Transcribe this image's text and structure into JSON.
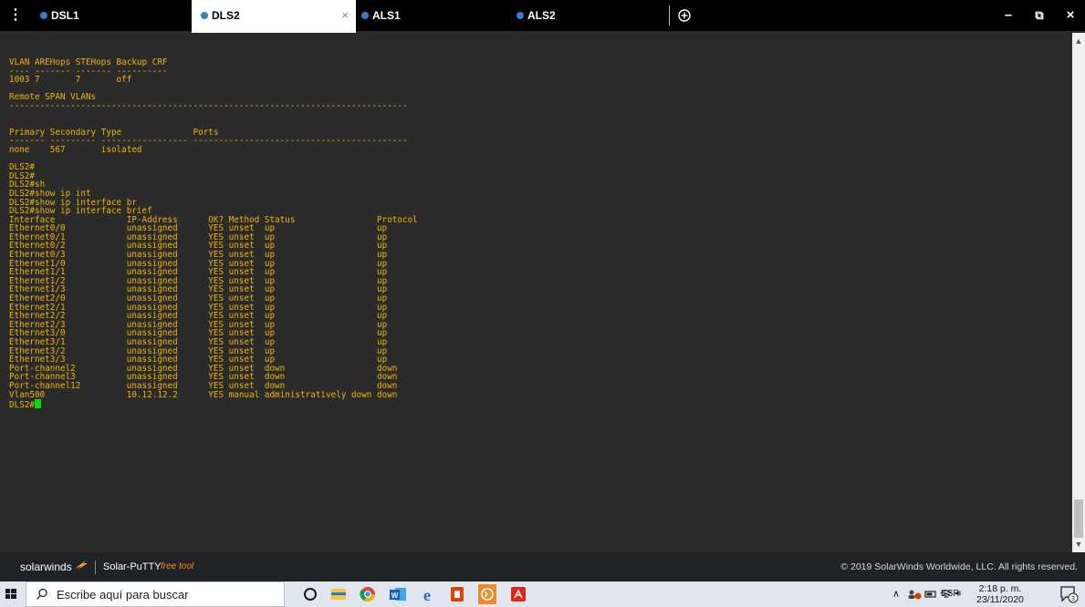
{
  "tabs": [
    {
      "label": "DSL1",
      "active": false,
      "dot_color": "#2f7fd6"
    },
    {
      "label": "DLS2",
      "active": true,
      "dot_color": "#2f7fd6"
    },
    {
      "label": "ALS1",
      "active": false,
      "dot_color": "#2f7fd6"
    },
    {
      "label": "ALS2",
      "active": false,
      "dot_color": "#2f7fd6"
    }
  ],
  "tab_close_symbol": "×",
  "menu_icon": "vertical-dots-icon",
  "add_tab_icon": "plus-circle-icon",
  "window_controls": {
    "minimize": "–",
    "restore": "⧉",
    "close": "×"
  },
  "terminal": {
    "text_color": "#f0b400",
    "lines": [
      "VLAN AREHops STEHops Backup CRF",
      "---- ------- ------- ----------",
      "1003 7       7       off",
      "",
      "Remote SPAN VLANs",
      "------------------------------------------------------------------------------",
      "",
      "",
      "Primary Secondary Type              Ports",
      "------- --------- ----------------- ------------------------------------------",
      "none    567       isolated",
      "",
      "DLS2#",
      "DLS2#",
      "DLS2#sh",
      "DLS2#show ip int",
      "DLS2#show ip interface br",
      "DLS2#show ip interface brief",
      "Interface              IP-Address      OK? Method Status                Protocol",
      "Ethernet0/0            unassigned      YES unset  up                    up",
      "Ethernet0/1            unassigned      YES unset  up                    up",
      "Ethernet0/2            unassigned      YES unset  up                    up",
      "Ethernet0/3            unassigned      YES unset  up                    up",
      "Ethernet1/0            unassigned      YES unset  up                    up",
      "Ethernet1/1            unassigned      YES unset  up                    up",
      "Ethernet1/2            unassigned      YES unset  up                    up",
      "Ethernet1/3            unassigned      YES unset  up                    up",
      "Ethernet2/0            unassigned      YES unset  up                    up",
      "Ethernet2/1            unassigned      YES unset  up                    up",
      "Ethernet2/2            unassigned      YES unset  up                    up",
      "Ethernet2/3            unassigned      YES unset  up                    up",
      "Ethernet3/0            unassigned      YES unset  up                    up",
      "Ethernet3/1            unassigned      YES unset  up                    up",
      "Ethernet3/2            unassigned      YES unset  up                    up",
      "Ethernet3/3            unassigned      YES unset  up                    up",
      "Port-channel2          unassigned      YES unset  down                  down",
      "Port-channel3          unassigned      YES unset  down                  down",
      "Port-channel12         unassigned      YES unset  down                  down",
      "Vlan500                10.12.12.2      YES manual administratively down down"
    ],
    "prompt": "DLS2#",
    "cursor_color": "#00e000"
  },
  "footer": {
    "brand": "solarwinds",
    "product": "Solar-PuTTY",
    "product_sub": "free tool",
    "copyright": "© 2019 SolarWinds Worldwide, LLC. All rights reserved."
  },
  "taskbar": {
    "search_placeholder": "Escribe aquí para buscar",
    "apps": [
      "cortana-circle-icon",
      "file-explorer-icon",
      "chrome-icon",
      "word-icon",
      "edge-icon",
      "office-icon",
      "solar-putty-icon",
      "acrobat-icon"
    ],
    "language": "ESP",
    "time": "2:18 p. m.",
    "date": "23/11/2020",
    "notification_count": "3"
  }
}
